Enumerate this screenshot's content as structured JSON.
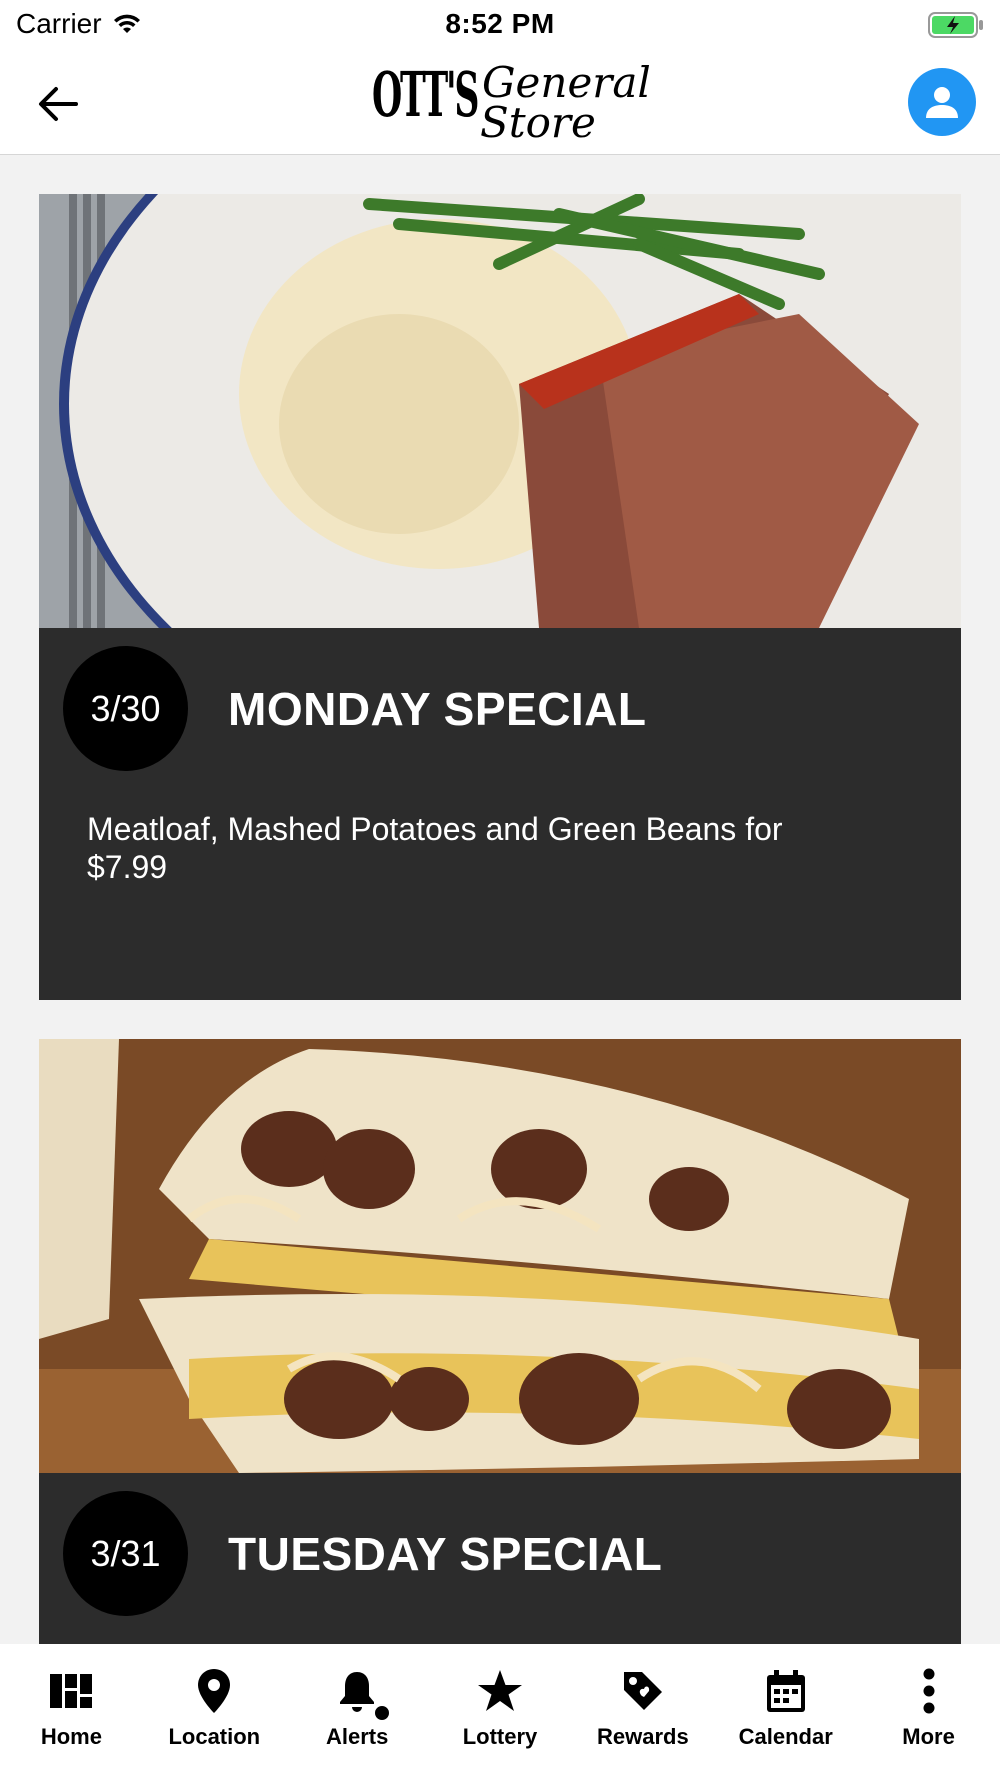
{
  "status_bar": {
    "carrier": "Carrier",
    "time": "8:52 PM",
    "battery_color": "#4cd964"
  },
  "header": {
    "back_icon": "back-arrow-icon",
    "logo": {
      "mark": "OTT'S",
      "line1": "General",
      "line2": "Store"
    },
    "profile_icon": "user-icon",
    "accent": "#2196f3"
  },
  "specials": [
    {
      "date": "3/30",
      "title": "MONDAY SPECIAL",
      "description": "Meatloaf, Mashed Potatoes and Green Beans for $7.99",
      "image": "meatloaf-plate-image"
    },
    {
      "date": "3/31",
      "title": "TUESDAY SPECIAL",
      "description": "",
      "image": "steak-quesadilla-image"
    }
  ],
  "tabbar": {
    "items": [
      {
        "label": "Home",
        "icon": "dashboard-icon"
      },
      {
        "label": "Location",
        "icon": "map-pin-icon"
      },
      {
        "label": "Alerts",
        "icon": "bell-icon"
      },
      {
        "label": "Lottery",
        "icon": "star-icon"
      },
      {
        "label": "Rewards",
        "icon": "tag-icon"
      },
      {
        "label": "Calendar",
        "icon": "calendar-icon"
      },
      {
        "label": "More",
        "icon": "more-vertical-icon"
      }
    ]
  },
  "colors": {
    "card_background": "#2c2c2c",
    "page_background": "#f2f2f2",
    "badge_background": "#000000"
  }
}
